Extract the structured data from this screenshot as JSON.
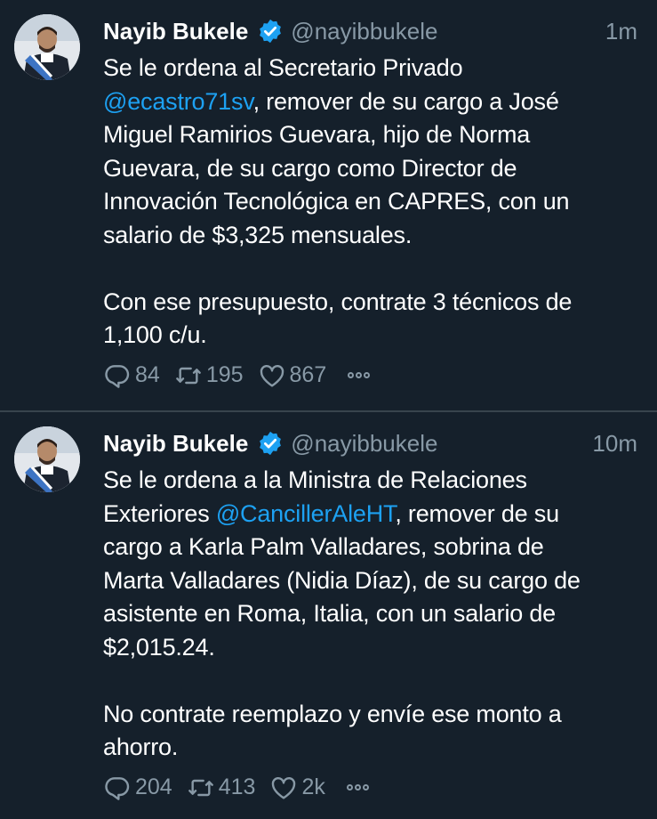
{
  "tweets": [
    {
      "name": "Nayib Bukele",
      "handle": "@nayibbukele",
      "time": "1m",
      "line1_pre": "Se le ordena al Secretario Privado",
      "mention": "@ecastro71sv",
      "line2_post": ", remover de su cargo a José",
      "lines_after": [
        "Miguel Ramirios Guevara, hijo de Norma",
        "Guevara, de su cargo como Director de",
        "Innovación Tecnológica en CAPRES, con un",
        "salario de $3,325 mensuales."
      ],
      "paragraph2": [
        "Con ese presupuesto, contrate 3 técnicos de",
        "1,100 c/u."
      ],
      "replies": "84",
      "retweets": "195",
      "likes": "867"
    },
    {
      "name": "Nayib Bukele",
      "handle": "@nayibbukele",
      "time": "10m",
      "line1_pre": "Se le ordena a la Ministra de Relaciones",
      "line2_pre": "Exteriores ",
      "mention": "@CancillerAleHT",
      "line2_post": ", remover de su",
      "lines_after": [
        "cargo a Karla Palm Valladares, sobrina de",
        "Marta Valladares (Nidia Díaz), de su cargo de",
        "asistente en Roma, Italia, con un salario de",
        "$2,015.24."
      ],
      "paragraph2": [
        "No contrate reemplazo y envíe ese monto a",
        "ahorro."
      ],
      "replies": "204",
      "retweets": "413",
      "likes": "2k"
    }
  ],
  "icons": {
    "reply": "reply-icon",
    "retweet": "retweet-icon",
    "like": "heart-icon",
    "more": "more-icon",
    "verified": "verified-badge-icon"
  },
  "colors": {
    "background": "#15202b",
    "divider": "#38444d",
    "secondary_text": "#8899a6",
    "mention": "#1da1f2",
    "verified": "#1da1f2"
  }
}
